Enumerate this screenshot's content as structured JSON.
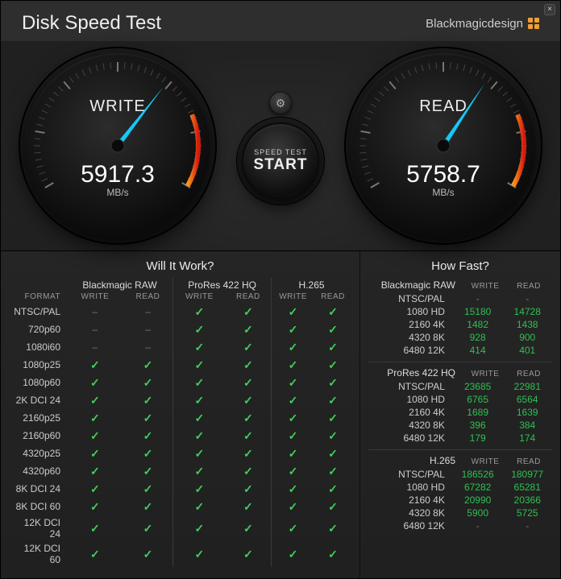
{
  "title": "Disk Speed Test",
  "brand": "Blackmagicdesign",
  "gauges": {
    "write": {
      "label": "WRITE",
      "value": "5917.3",
      "unit": "MB/s",
      "max": 9000
    },
    "read": {
      "label": "READ",
      "value": "5758.7",
      "unit": "MB/s",
      "max": 9000
    }
  },
  "start": {
    "line1": "SPEED TEST",
    "line2": "START"
  },
  "willItWork": {
    "heading": "Will It Work?",
    "format_label": "FORMAT",
    "columns": {
      "codecs": [
        "Blackmagic RAW",
        "ProRes 422 HQ",
        "H.265"
      ],
      "rw": [
        "WRITE",
        "READ"
      ]
    },
    "rows": [
      {
        "f": "NTSC/PAL",
        "v": [
          "-",
          "-",
          "y",
          "y",
          "y",
          "y"
        ]
      },
      {
        "f": "720p60",
        "v": [
          "-",
          "-",
          "y",
          "y",
          "y",
          "y"
        ]
      },
      {
        "f": "1080i60",
        "v": [
          "-",
          "-",
          "y",
          "y",
          "y",
          "y"
        ]
      },
      {
        "f": "1080p25",
        "v": [
          "y",
          "y",
          "y",
          "y",
          "y",
          "y"
        ]
      },
      {
        "f": "1080p60",
        "v": [
          "y",
          "y",
          "y",
          "y",
          "y",
          "y"
        ]
      },
      {
        "f": "2K DCI 24",
        "v": [
          "y",
          "y",
          "y",
          "y",
          "y",
          "y"
        ]
      },
      {
        "f": "2160p25",
        "v": [
          "y",
          "y",
          "y",
          "y",
          "y",
          "y"
        ]
      },
      {
        "f": "2160p60",
        "v": [
          "y",
          "y",
          "y",
          "y",
          "y",
          "y"
        ]
      },
      {
        "f": "4320p25",
        "v": [
          "y",
          "y",
          "y",
          "y",
          "y",
          "y"
        ]
      },
      {
        "f": "4320p60",
        "v": [
          "y",
          "y",
          "y",
          "y",
          "y",
          "y"
        ]
      },
      {
        "f": "8K DCI 24",
        "v": [
          "y",
          "y",
          "y",
          "y",
          "y",
          "y"
        ]
      },
      {
        "f": "8K DCI 60",
        "v": [
          "y",
          "y",
          "y",
          "y",
          "y",
          "y"
        ]
      },
      {
        "f": "12K DCI 24",
        "v": [
          "y",
          "y",
          "y",
          "y",
          "y",
          "y"
        ]
      },
      {
        "f": "12K DCI 60",
        "v": [
          "y",
          "y",
          "y",
          "y",
          "y",
          "y"
        ]
      }
    ]
  },
  "howFast": {
    "heading": "How Fast?",
    "rw": [
      "WRITE",
      "READ"
    ],
    "groups": [
      {
        "name": "Blackmagic RAW",
        "rows": [
          {
            "res": "NTSC/PAL",
            "w": "-",
            "r": "-"
          },
          {
            "res": "1080 HD",
            "w": "15180",
            "r": "14728"
          },
          {
            "res": "2160 4K",
            "w": "1482",
            "r": "1438"
          },
          {
            "res": "4320 8K",
            "w": "928",
            "r": "900"
          },
          {
            "res": "6480 12K",
            "w": "414",
            "r": "401"
          }
        ]
      },
      {
        "name": "ProRes 422 HQ",
        "rows": [
          {
            "res": "NTSC/PAL",
            "w": "23685",
            "r": "22981"
          },
          {
            "res": "1080 HD",
            "w": "6765",
            "r": "6564"
          },
          {
            "res": "2160 4K",
            "w": "1689",
            "r": "1639"
          },
          {
            "res": "4320 8K",
            "w": "396",
            "r": "384"
          },
          {
            "res": "6480 12K",
            "w": "179",
            "r": "174"
          }
        ]
      },
      {
        "name": "H.265",
        "rows": [
          {
            "res": "NTSC/PAL",
            "w": "186526",
            "r": "180977"
          },
          {
            "res": "1080 HD",
            "w": "67282",
            "r": "65281"
          },
          {
            "res": "2160 4K",
            "w": "20990",
            "r": "20366"
          },
          {
            "res": "4320 8K",
            "w": "5900",
            "r": "5725"
          },
          {
            "res": "6480 12K",
            "w": "-",
            "r": "-"
          }
        ]
      }
    ]
  }
}
